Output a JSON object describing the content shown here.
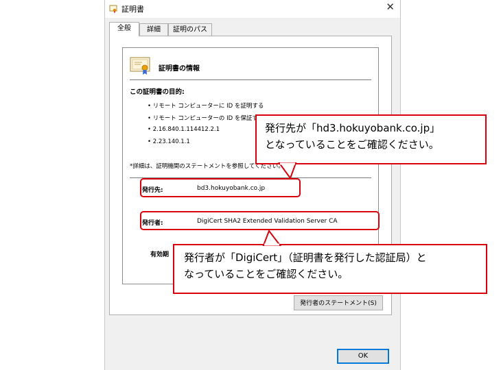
{
  "window": {
    "title": "証明書",
    "close_glyph": "✕"
  },
  "tabs": [
    {
      "label": "全般",
      "active": true
    },
    {
      "label": "詳細",
      "active": false
    },
    {
      "label": "証明のパス",
      "active": false
    }
  ],
  "info": {
    "title": "証明書の情報",
    "purpose_label": "この証明書の目的:",
    "purposes": [
      "• リモート コンピューターに ID を証明する",
      "• リモート コンピューターの ID を保証する",
      "• 2.16.840.1.114412.2.1",
      "• 2.23.140.1.1"
    ],
    "note": "*詳細は、証明機関のステートメントを参照してください。",
    "issued_to_label": "発行先:",
    "issued_to_value": "bd3.hokuyobank.co.jp",
    "issued_by_label": "発行者:",
    "issued_by_value": "DigiCert SHA2 Extended Validation Server CA",
    "validity_label": "有効期"
  },
  "buttons": {
    "issuer_statement": "発行者のステートメント(S)",
    "ok": "OK"
  },
  "callouts": {
    "issued_to": {
      "line1": "発行先が「hd3.hokuyobank.co.jp」",
      "line2": "となっていることをご確認ください。"
    },
    "issued_by": {
      "line1": "発行者が「DigiCert」（証明書を発行した認証局）と",
      "line2": "なっていることをご確認ください。"
    }
  },
  "colors": {
    "annotation_red": "#d9000d",
    "ok_border": "#0078d7"
  }
}
